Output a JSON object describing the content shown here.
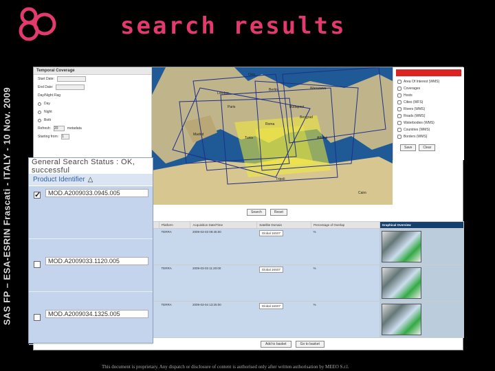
{
  "slide": {
    "title": "search results",
    "vertical_caption": "SAS FP – ESA-ESRIN Frascati - ITALY - 10 Nov. 2009",
    "footer": "This document is proprietary. Any dispatch or disclosure of content is authorised only after written authorisation by MEEO S.r.l.",
    "accent_color": "#e23a6d",
    "logo_icon": "eighty-logo-icon"
  },
  "form": {
    "header": "Temporal Coverage",
    "start_label": "Start Date:",
    "end_label": "End Date:",
    "daylight_label": "Day/Night Flag",
    "opt_day": "Day",
    "opt_night": "Night",
    "opt_both": "Both",
    "refresh_label": "Refresh:",
    "refresh_value": "20",
    "refresh_unit": "metadata",
    "starting_label": "Starting from:",
    "starting_value": "1"
  },
  "layers": {
    "items": [
      "Area Of Interest (WMS)",
      "Coverages",
      "Hosts",
      "Cities (WFS)",
      "Rivers (WMS)",
      "Roads (WMS)",
      "Waterbodies (WMS)",
      "Countries (WMS)",
      "Borders (WMS)"
    ],
    "save": "Save",
    "clear": "Clear"
  },
  "map": {
    "labels": [
      "Tunis",
      "Roma",
      "Athinai",
      "Beograd",
      "Budapest",
      "Berlin",
      "Warszawa",
      "Paris",
      "London",
      "Madrid",
      "Cairo",
      "Tripoli",
      "Oslo"
    ],
    "search_btn": "Search",
    "reset_btn": "Reset"
  },
  "results": {
    "columns": [
      "",
      "Platform",
      "Acquisition Date/Time",
      "Satellite Domain",
      "Percentage of Overlap",
      "Graphical Overview"
    ],
    "rows": [
      {
        "platform": "TERRA",
        "datetime": "2009-03-03 09:45:00",
        "domain": "Global 16S07",
        "overlap": "%"
      },
      {
        "platform": "TERRA",
        "datetime": "2009-03-03 11:20:00",
        "domain": "Global 16S07",
        "overlap": "%"
      },
      {
        "platform": "TERRA",
        "datetime": "2009-03-04 13:25:00",
        "domain": "Global 16S07",
        "overlap": "%"
      }
    ],
    "add_to_basket": "Add to basket",
    "go_to_basket": "Go to basket"
  },
  "overlay": {
    "status": "General Search Status : OK, successful",
    "column_header": "Product Identifier",
    "products": [
      {
        "id": "MOD.A2009033.0945.005",
        "checked": true
      },
      {
        "id": "MOD.A2009033.1120.005",
        "checked": false
      },
      {
        "id": "MOD.A2009034.1325.005",
        "checked": false
      }
    ]
  }
}
